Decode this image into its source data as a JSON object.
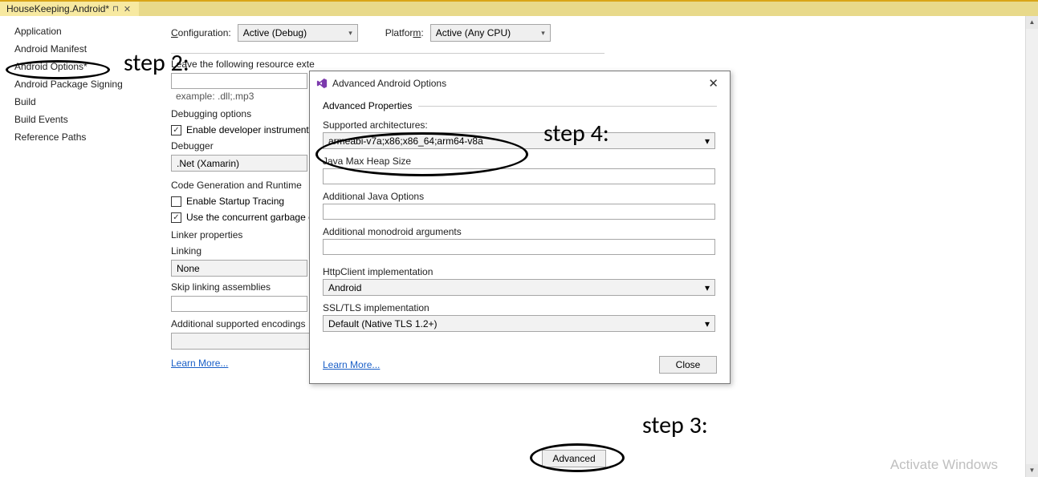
{
  "tab": {
    "title": "HouseKeeping.Android*"
  },
  "sidebar": {
    "items": [
      "Application",
      "Android Manifest",
      "Android Options*",
      "Android Package Signing",
      "Build",
      "Build Events",
      "Reference Paths"
    ]
  },
  "main": {
    "configuration_label": "Configuration:",
    "configuration_value": "Active (Debug)",
    "platform_label": "Platform:",
    "platform_value": "Active (Any CPU)",
    "resource_ext_label": "Leave the following resource exte",
    "resource_ext_value": "",
    "resource_ext_hint": "example: .dll;.mp3",
    "debugging_label": "Debugging options",
    "enable_dev_inst": "Enable developer instrumenta",
    "debugger_label": "Debugger",
    "debugger_value": ".Net (Xamarin)",
    "codegen_label": "Code Generation and Runtime",
    "startup_trace": "Enable Startup Tracing",
    "concurrent_gc": "Use the concurrent garbage c",
    "linker_label": "Linker properties",
    "linking_label": "Linking",
    "linking_value": "None",
    "skip_linking": "Skip linking assemblies",
    "skip_linking_value": "",
    "additional_enc": "Additional supported encodings",
    "learn_more": "Learn More...",
    "advanced_btn": "Advanced"
  },
  "dialog": {
    "title": "Advanced Android Options",
    "section": "Advanced Properties",
    "arch_label": "Supported architectures:",
    "arch_value": "armeabi-v7a;x86;x86_64;arm64-v8a",
    "heap_label": "Java Max Heap Size",
    "heap_value": "",
    "javaopts_label": "Additional Java Options",
    "javaopts_value": "",
    "mono_label": "Additional monodroid arguments",
    "mono_value": "",
    "httpclient_label": "HttpClient implementation",
    "httpclient_value": "Android",
    "ssl_label": "SSL/TLS implementation",
    "ssl_value": "Default (Native TLS 1.2+)",
    "learn_more": "Learn More...",
    "close": "Close"
  },
  "annotations": {
    "step2": "step 2:",
    "step3": "step 3:",
    "step4": "step 4:"
  },
  "watermark": "Activate Windows"
}
